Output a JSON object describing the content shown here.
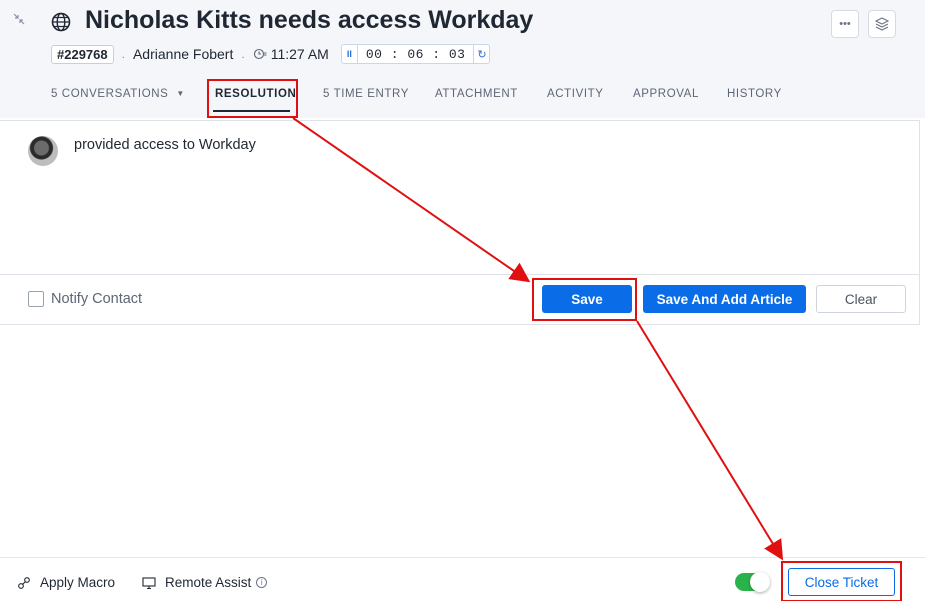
{
  "header": {
    "title": "Nicholas Kitts needs access Workday",
    "ticket_id": "#229768",
    "requester": "Adrianne Fobert",
    "time": "11:27 AM",
    "timer": "00 : 06 : 03",
    "separator": "."
  },
  "tabs": [
    {
      "label": "5 CONVERSATIONS",
      "active": false
    },
    {
      "label": "RESOLUTION",
      "active": true
    },
    {
      "label": "5 TIME ENTRY",
      "active": false
    },
    {
      "label": "ATTACHMENT",
      "active": false
    },
    {
      "label": "ACTIVITY",
      "active": false
    },
    {
      "label": "APPROVAL",
      "active": false
    },
    {
      "label": "HISTORY",
      "active": false
    }
  ],
  "resolution": {
    "text": "provided access to Workday",
    "notify_label": "Notify Contact",
    "notify_checked": false,
    "save_label": "Save",
    "save_article_label": "Save And Add Article",
    "clear_label": "Clear"
  },
  "footer": {
    "apply_macro": "Apply Macro",
    "remote_assist": "Remote Assist",
    "toggle_on": true,
    "close_ticket": "Close Ticket"
  },
  "colors": {
    "primary": "#0a6ce6",
    "annotation": "#e01010",
    "toggle": "#2bb34b"
  }
}
